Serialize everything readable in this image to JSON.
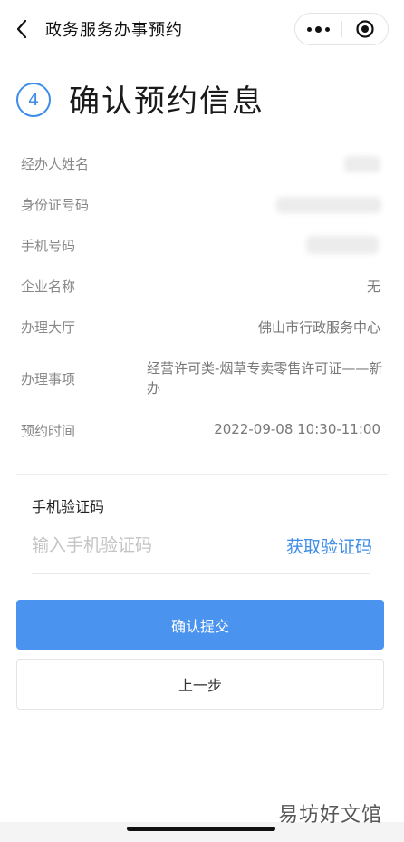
{
  "header": {
    "title": "政务服务办事预约",
    "back_icon": "chevron-left-icon",
    "more_icon": "more-dots-icon",
    "close_icon": "target-circle-icon"
  },
  "step": {
    "number": "4",
    "title": "确认预约信息",
    "accent_color": "#3e8de8"
  },
  "info": {
    "rows": [
      {
        "label": "经办人姓名",
        "value": ""
      },
      {
        "label": "身份证号码",
        "value": ""
      },
      {
        "label": "手机号码",
        "value": ""
      },
      {
        "label": "企业名称",
        "value": "无"
      },
      {
        "label": "办理大厅",
        "value": "佛山市行政服务中心"
      },
      {
        "label": "办理事项",
        "value": "经营许可类-烟草专卖零售许可证——新办"
      },
      {
        "label": "预约时间",
        "value": "2022-09-08 10:30-11:00"
      }
    ]
  },
  "sms": {
    "label": "手机验证码",
    "placeholder": "输入手机验证码",
    "value": "",
    "get_code_label": "获取验证码"
  },
  "actions": {
    "confirm_label": "确认提交",
    "prev_label": "上一步",
    "primary_color": "#4a93ee"
  },
  "watermark": "易坊好文馆"
}
